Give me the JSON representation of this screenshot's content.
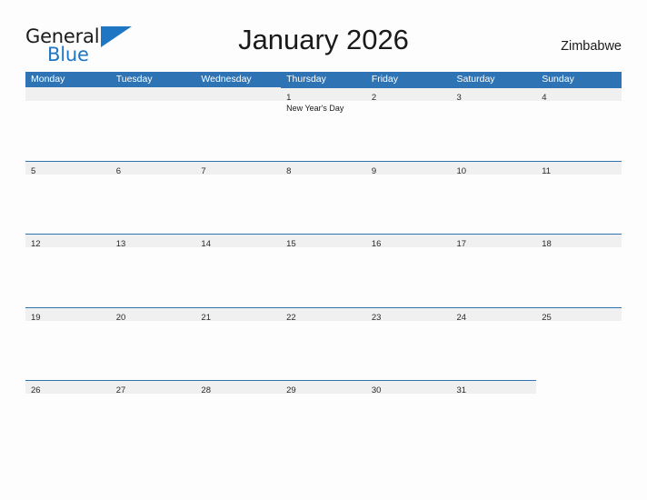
{
  "brand": {
    "word_one": "General",
    "word_two": "Blue",
    "flag_icon": "blue-flag-triangle",
    "color_dark": "#1a1a1a",
    "color_blue": "#1f77c4"
  },
  "header": {
    "title": "January 2026",
    "country": "Zimbabwe"
  },
  "calendar": {
    "header_color": "#2e74b5",
    "band_color": "#f0f0f0",
    "weekdays": [
      "Monday",
      "Tuesday",
      "Wednesday",
      "Thursday",
      "Friday",
      "Saturday",
      "Sunday"
    ],
    "weeks": [
      [
        {
          "date": "",
          "state": "empty-lead",
          "events": []
        },
        {
          "date": "",
          "state": "empty-lead",
          "events": []
        },
        {
          "date": "",
          "state": "empty-lead",
          "events": []
        },
        {
          "date": "1",
          "state": "filled",
          "events": [
            "New Year's Day"
          ]
        },
        {
          "date": "2",
          "state": "filled",
          "events": []
        },
        {
          "date": "3",
          "state": "filled",
          "events": []
        },
        {
          "date": "4",
          "state": "filled",
          "events": []
        }
      ],
      [
        {
          "date": "5",
          "state": "filled",
          "events": []
        },
        {
          "date": "6",
          "state": "filled",
          "events": []
        },
        {
          "date": "7",
          "state": "filled",
          "events": []
        },
        {
          "date": "8",
          "state": "filled",
          "events": []
        },
        {
          "date": "9",
          "state": "filled",
          "events": []
        },
        {
          "date": "10",
          "state": "filled",
          "events": []
        },
        {
          "date": "11",
          "state": "filled",
          "events": []
        }
      ],
      [
        {
          "date": "12",
          "state": "filled",
          "events": []
        },
        {
          "date": "13",
          "state": "filled",
          "events": []
        },
        {
          "date": "14",
          "state": "filled",
          "events": []
        },
        {
          "date": "15",
          "state": "filled",
          "events": []
        },
        {
          "date": "16",
          "state": "filled",
          "events": []
        },
        {
          "date": "17",
          "state": "filled",
          "events": []
        },
        {
          "date": "18",
          "state": "filled",
          "events": []
        }
      ],
      [
        {
          "date": "19",
          "state": "filled",
          "events": []
        },
        {
          "date": "20",
          "state": "filled",
          "events": []
        },
        {
          "date": "21",
          "state": "filled",
          "events": []
        },
        {
          "date": "22",
          "state": "filled",
          "events": []
        },
        {
          "date": "23",
          "state": "filled",
          "events": []
        },
        {
          "date": "24",
          "state": "filled",
          "events": []
        },
        {
          "date": "25",
          "state": "filled",
          "events": []
        }
      ],
      [
        {
          "date": "26",
          "state": "filled",
          "events": []
        },
        {
          "date": "27",
          "state": "filled",
          "events": []
        },
        {
          "date": "28",
          "state": "filled",
          "events": []
        },
        {
          "date": "29",
          "state": "filled",
          "events": []
        },
        {
          "date": "30",
          "state": "filled",
          "events": []
        },
        {
          "date": "31",
          "state": "filled",
          "events": []
        },
        {
          "date": "",
          "state": "blank",
          "events": []
        }
      ]
    ]
  }
}
